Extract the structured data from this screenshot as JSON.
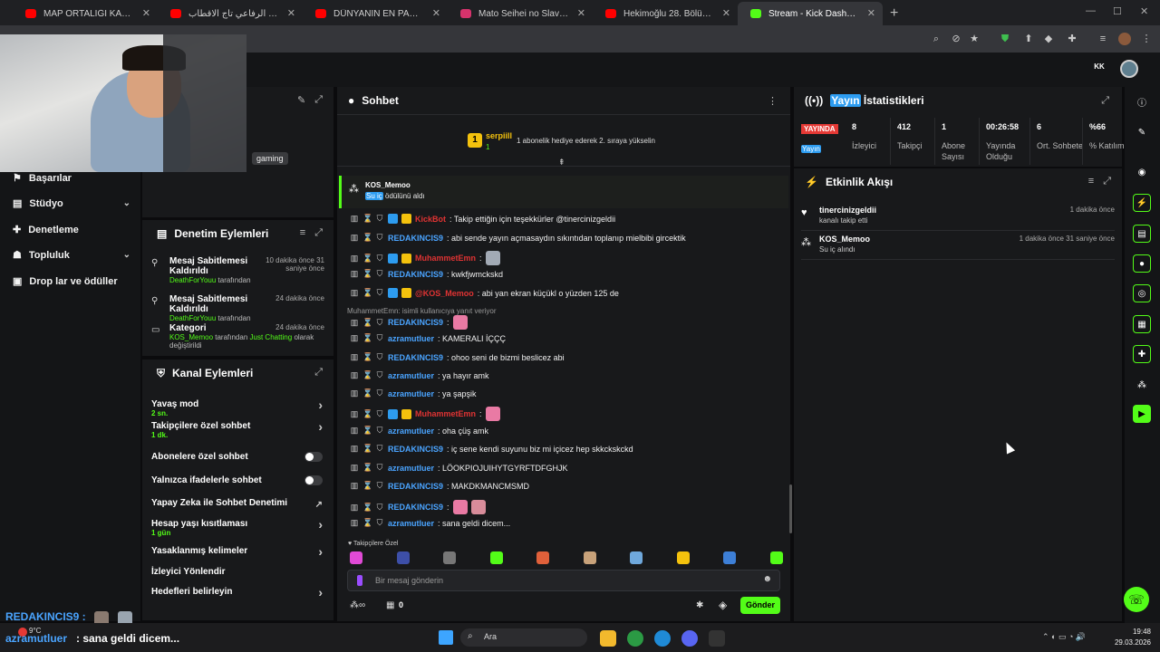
{
  "browser": {
    "tabs": [
      {
        "title": "MAP ORTALIĞI KARIŞTIRDI! | PU",
        "color": "#ff0000",
        "active": false
      },
      {
        "title": "سيد احمد الرفاعي تاج الاقطاب (e",
        "color": "#ff0000",
        "active": false
      },
      {
        "title": "DÜNYANIN EN PARANORMAL",
        "color": "#ff0000",
        "active": false
      },
      {
        "title": "Mato Seihei no Slave 1. Bölüm",
        "color": "#d6336c",
        "active": false
      },
      {
        "title": "Hekimoğlu 28. Bölüm | FULL BÖ",
        "color": "#ff0000",
        "active": false
      },
      {
        "title": "Stream - Kick Dashboard",
        "color": "#53fc18",
        "active": true
      }
    ],
    "new_tab": "+",
    "controls": [
      "—",
      "☐",
      "✕"
    ]
  },
  "stream_info": {
    "tag": "gaming"
  },
  "left_nav": {
    "items": [
      {
        "label": "Başarılar",
        "icon": "trophy-icon",
        "has_chevron": false
      },
      {
        "label": "Stüdyo",
        "icon": "studio-icon",
        "has_chevron": true
      },
      {
        "label": "Denetleme",
        "icon": "wrench-icon",
        "has_chevron": false
      },
      {
        "label": "Topluluk",
        "icon": "community-icon",
        "has_chevron": true,
        "highlight": "Top"
      },
      {
        "label": "Drop lar ve ödüller",
        "icon": "gift-icon",
        "has_chevron": false,
        "highlight": "Drop"
      }
    ]
  },
  "mod_actions": {
    "title": "Denetim Eylemleri",
    "rows": [
      {
        "title": "Mesaj Sabitlemesi Kaldırıldı",
        "time": "10 dakika önce 31 saniye önce",
        "user": "DeathForYouu",
        "suffix": " tarafından",
        "icon": "pin-off-icon"
      },
      {
        "title": "Mesaj Sabitlemesi Kaldırıldı",
        "time": "24 dakika önce",
        "user": "DeathForYouu",
        "suffix": " tarafından",
        "icon": "pin-off-icon"
      },
      {
        "title": "Kategori",
        "time": "24 dakika önce",
        "user": "KOS_Memoo",
        "suffix": " tarafından ",
        "value": "Just Chatting",
        "suffix2": " olarak değiştirildi",
        "icon": "category-icon"
      }
    ]
  },
  "channel_actions": {
    "title": "Kanal Eylemleri",
    "rows": [
      {
        "label": "Yavaş mod",
        "sub": "2 sn.",
        "control": "chevron"
      },
      {
        "label": "Takipçilere özel sohbet",
        "sub": "1 dk.",
        "control": "chevron"
      },
      {
        "label": "Abonelere özel sohbet",
        "sub": "",
        "control": "toggle"
      },
      {
        "label": "Yalnızca ifadelerle sohbet",
        "sub": "",
        "control": "toggle"
      },
      {
        "label": "Yapay Zeka ile Sohbet Denetimi",
        "sub": "",
        "control": "external"
      },
      {
        "label": "Hesap yaşı kısıtlaması",
        "sub": "1 gün",
        "control": "chevron"
      },
      {
        "label": "Yasaklanmış kelimeler",
        "sub": "",
        "control": "chevron"
      },
      {
        "label": "İzleyici Yönlendir",
        "sub": "",
        "control": "none"
      },
      {
        "label": "Hedefleri belirleyin",
        "sub": "",
        "control": "chevron"
      }
    ]
  },
  "chat": {
    "title": "Sohbet",
    "pinned": {
      "user": "serpiill",
      "count": "1",
      "text": "1 abonelik hediye ederek 2. sıraya yükselin"
    },
    "redeem": {
      "user": "KOS_Memoo",
      "text_hl": "Su iç",
      "text": " ödülünü aldı"
    },
    "messages": [
      {
        "user": "KickBot",
        "color": "red",
        "text": ": Takip ettiğin için teşekkürler @tinercinizgeldii",
        "badges": 2
      },
      {
        "user": "REDAKINCIS9",
        "color": "blue",
        "text": ": abi sende yayın açmasaydın sıkıntıdan toplanıp mielbibi gircektik",
        "badges": 0
      },
      {
        "user": "MuhammetEmn",
        "color": "red",
        "text": ":",
        "badges": 2,
        "emotes": 1
      },
      {
        "user": "REDAKINCIS9",
        "color": "blue",
        "text": ": kwkfjwmckskd",
        "badges": 0
      },
      {
        "user": "@KOS_Memoo",
        "color": "red",
        "text": ": abi yan ekran küçükl o yüzden 125 de",
        "badges": 2
      },
      {
        "user": "REDAKINCIS9",
        "color": "blue",
        "text": ":",
        "badges": 0,
        "emotes": 1,
        "reply": "MuhammetEmn: isimli kullanıcıya yanıt veriyor"
      },
      {
        "user": "azramutluer",
        "color": "blue",
        "text": ": KAMERALI İÇÇÇ",
        "badges": 0
      },
      {
        "user": "REDAKINCIS9",
        "color": "blue",
        "text": ": ohoo seni de bizmi beslicez abi",
        "badges": 0
      },
      {
        "user": "azramutluer",
        "color": "blue",
        "text": ": ya hayır amk",
        "badges": 0
      },
      {
        "user": "azramutluer",
        "color": "blue",
        "text": ": ya şapşik",
        "badges": 0
      },
      {
        "user": "MuhammetEmn",
        "color": "red",
        "text": ":",
        "badges": 2,
        "emotes": 1
      },
      {
        "user": "azramutluer",
        "color": "blue",
        "text": ": oha çüş amk",
        "badges": 0
      },
      {
        "user": "REDAKINCIS9",
        "color": "blue",
        "text": ": iç sene kendi suyunu biz mi içicez hep skkckskckd",
        "badges": 0
      },
      {
        "user": "azramutluer",
        "color": "blue",
        "text": ": LÖOKPIOJUIHYTGYRFTDFGHJK",
        "badges": 0
      },
      {
        "user": "REDAKINCIS9",
        "color": "blue",
        "text": ": MAKDKMANCMSMD",
        "badges": 0
      },
      {
        "user": "REDAKINCIS9",
        "color": "blue",
        "text": ":",
        "badges": 0,
        "emotes": 2
      },
      {
        "user": "azramutluer",
        "color": "blue",
        "text": ": sana geldi dicem...",
        "badges": 0
      }
    ],
    "emote_bar_label": "Takipçilere Özel",
    "input_placeholder": "Bir mesaj gönderin",
    "points": "0",
    "send_label": "Gönder"
  },
  "stats": {
    "title": "Yayın İstatistikleri",
    "live_badge": "YAYINDA",
    "live_sub": "Yayın",
    "items": [
      {
        "value": "8",
        "label": "İzleyici"
      },
      {
        "value": "412",
        "label": "Takipçi"
      },
      {
        "value": "1",
        "label": "Abone Sayısı"
      },
      {
        "value": "00:26:58",
        "label": "Yayında Olduğu"
      },
      {
        "value": "6",
        "label": "Ort. Sohbete"
      },
      {
        "value": "%66",
        "label": "% Katılım"
      }
    ]
  },
  "activity": {
    "title": "Etkinlik Akışı",
    "rows": [
      {
        "user": "tinercinizgeldii",
        "text": "kanalı takip etti",
        "time": "1 dakika önce",
        "icon": "heart-icon"
      },
      {
        "user": "KOS_Memoo",
        "text": "Su iç alındı",
        "time": "1 dakika önce 31 saniye önce",
        "icon": "redeem-icon"
      }
    ]
  },
  "overlay": {
    "chat_user1": "REDAKINCIS9 :",
    "chat_user2": "azramutluer",
    "chat_text2": ": sana geldi dicem...",
    "weather": "9°C"
  },
  "taskbar": {
    "search": "Ara",
    "time": "19:48",
    "date": "29.03.2026"
  },
  "colors": {
    "kick_green": "#53fc18",
    "highlight": "#2d9cf0",
    "live_red": "#e53935"
  }
}
